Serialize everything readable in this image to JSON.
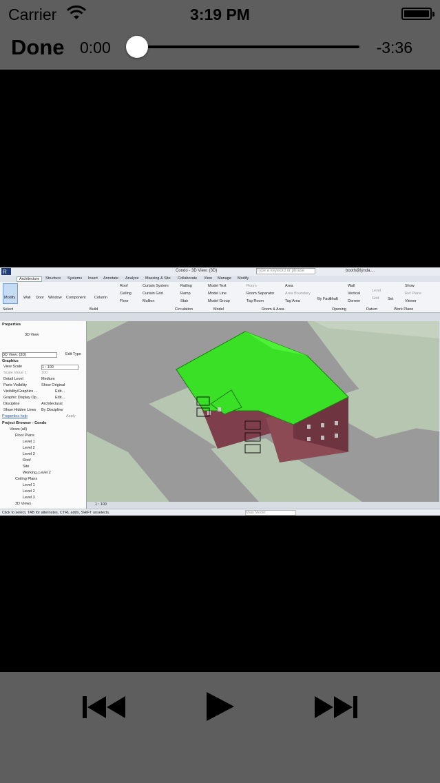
{
  "status_bar": {
    "carrier": "Carrier",
    "time": "3:19 PM"
  },
  "player": {
    "done_label": "Done",
    "elapsed": "0:00",
    "remaining": "-3:36",
    "progress": 0.0
  },
  "controls": {
    "previous": "rewind-icon",
    "play": "play-icon",
    "next": "fast-forward-icon"
  },
  "video": {
    "window_title": "Condo - 3D View: {3D}",
    "search_placeholder": "Type a keyword or phrase",
    "user": "booth@lynda....",
    "tabs": [
      "Architecture",
      "Structure",
      "Systems",
      "Insert",
      "Annotate",
      "Analyze",
      "Massing & Site",
      "Collaborate",
      "View",
      "Manage",
      "Modify"
    ],
    "ribbon": {
      "modify": "Modify",
      "select": "Select",
      "build_tools": [
        "Wall",
        "Door",
        "Window",
        "Component",
        "Column"
      ],
      "roof_tools": [
        "Roof",
        "Ceiling",
        "Floor"
      ],
      "curtain_tools": [
        "Curtain System",
        "Curtain Grid",
        "Mullion"
      ],
      "circulation_tools": [
        "Railing",
        "Ramp",
        "Stair"
      ],
      "model_tools": [
        "Model Text",
        "Model Line",
        "Model Group"
      ],
      "room_tools": [
        "Room",
        "Room Separator",
        "Tag Room"
      ],
      "area_tools": [
        "Area",
        "Area Boundary",
        "Tag Area"
      ],
      "opening_tools": [
        "By Face",
        "Shaft"
      ],
      "wall_tools": [
        "Wall",
        "Vertical",
        "Dormer"
      ],
      "datum_tools": [
        "Level",
        "Grid"
      ],
      "workplane_tools": [
        "Set",
        "Show",
        "Ref Plane",
        "Viewer"
      ],
      "groups": [
        "Build",
        "Circulation",
        "Model",
        "Room & Area",
        "Opening",
        "Datum",
        "Work Plane"
      ]
    },
    "properties": {
      "header": "Properties",
      "type": "3D View",
      "selector": "3D View: {3D}",
      "edit_type": "Edit Type",
      "section": "Graphics",
      "rows": [
        [
          "View Scale",
          "1 : 100"
        ],
        [
          "Scale Value 1:",
          "100"
        ],
        [
          "Detail Level",
          "Medium"
        ],
        [
          "Parts Visibility",
          "Show Original"
        ],
        [
          "Visibility/Graphics ...",
          "Edit..."
        ],
        [
          "Graphic Display Op...",
          "Edit..."
        ],
        [
          "Discipline",
          "Architectural"
        ],
        [
          "Show Hidden Lines",
          "By Discipline"
        ]
      ],
      "help": "Properties help",
      "apply": "Apply"
    },
    "browser": {
      "header": "Project Browser - Condo",
      "items": [
        "Views (all)",
        "Floor Plans",
        "Level 1",
        "Level 2",
        "Level 3",
        "Roof",
        "Site",
        "Working_Level 2",
        "Ceiling Plans",
        "Level 1",
        "Level 2",
        "Level 3",
        "3D Views"
      ]
    },
    "scale": "1 : 100",
    "status_text": "Click to select, TAB for alternates, CTRL adds, SHIFT unselects.",
    "model_dropdown": "Main Model"
  },
  "colors": {
    "bar_gray": "#5e5e5e",
    "roof_green": "#39e025",
    "brick": "#8c4a55",
    "ground": "#b8c7b3"
  }
}
